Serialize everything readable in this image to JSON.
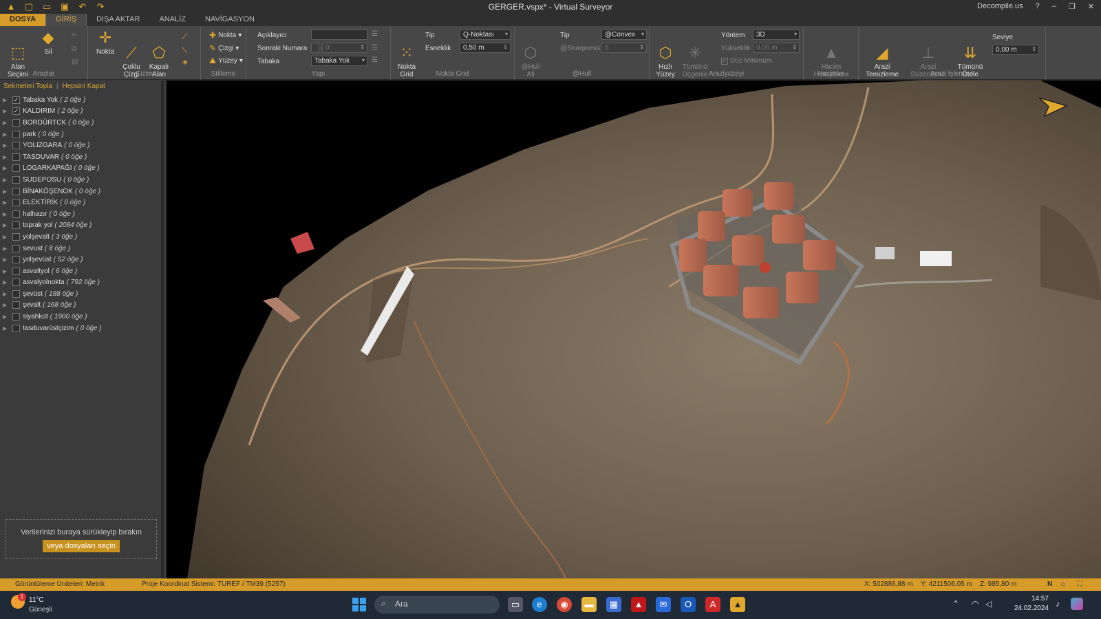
{
  "window": {
    "title": "GERGER.vspx*  -  Virtual Surveyor",
    "decompile": "Decompile.us",
    "help": "?",
    "minimize": "‒",
    "restore": "❐",
    "close": "✕"
  },
  "tabs": [
    "DOSYA",
    "GİRİŞ",
    "DIŞA AKTAR",
    "ANALİZ",
    "NAVİGASYON"
  ],
  "ribbon": {
    "araclar": {
      "label": "Araçlar",
      "alan_secimi": "Alan\nSeçimi",
      "sil": "Sil"
    },
    "cizim": {
      "label": "Çizim",
      "nokta": "Nokta",
      "coklu_cizgi": "Çoklu\nÇizgi",
      "kapali_alan": "Kapalı\nAlan"
    },
    "stilleme": {
      "label": "Stilleme",
      "nokta": "Nokta",
      "cizgi": "Çizgi",
      "yuzey": "Yüzey"
    },
    "yapi": {
      "label": "Yapı",
      "aciklayici": "Açıklayıcı",
      "sonraki_numara": "Sonraki Numara",
      "tabaka": "Tabaka",
      "sonraki_value": "0",
      "tabaka_value": "Tabaka Yok"
    },
    "nokta_grid": {
      "label": "Nokta Grid",
      "button": "Nokta\nGrid",
      "tip": "Tip",
      "esneklik": "Esneklik",
      "tip_value": "Q-Noktası",
      "esneklik_value": "0,50 m"
    },
    "hull": {
      "label": "@Hull",
      "button": "@Hull\nAll",
      "tip": "Tip",
      "sharpness": "@Sharpness",
      "tip_value": "@Convex",
      "sharpness_value": "5"
    },
    "araziyuzeyi": {
      "label": "Araziyüzeyi",
      "hizli": "Hızlı\nYüzey",
      "tumunu": "Tümünü\nÜçgenle",
      "yontem": "Yöntem",
      "yukseklik": "Yükseklik",
      "duz_minimum": "Düz Minimum",
      "yontem_value": "3D",
      "yukseklik_value": "0,00 m"
    },
    "hacimler": {
      "label": "Hacimler",
      "hacim": "Hacim\nHesaplama"
    },
    "arazi_islemleri": {
      "label": "Arazi İşlemleri",
      "temizleme": "Arazi\nTemizleme",
      "duzenleme": "Arazi\nDüzenleme",
      "otele": "Tümünü\nÖtele",
      "seviye": "Seviye",
      "seviye_value": "0,00 m"
    }
  },
  "panel": {
    "collapse": "Sekmeleri Topla",
    "close_all": "Hepsini Kapat",
    "layers": [
      {
        "name": "Tabaka Yok",
        "count": "( 2 öğe )",
        "checked": true
      },
      {
        "name": "KALDIRIM",
        "count": "( 2 öğe )",
        "checked": true
      },
      {
        "name": "BORDÜRTCK",
        "count": "( 0 öğe )",
        "checked": false
      },
      {
        "name": "park",
        "count": "( 0 öğe )",
        "checked": false
      },
      {
        "name": "YOLIZGARA",
        "count": "( 0 öğe )",
        "checked": false
      },
      {
        "name": "TASDUVAR",
        "count": "( 0 öğe )",
        "checked": false
      },
      {
        "name": "LOGARKAPAĞI",
        "count": "( 0 öğe )",
        "checked": false
      },
      {
        "name": "SUDEPOSU",
        "count": "( 0 öğe )",
        "checked": false
      },
      {
        "name": "BİNAKÖŞENOK",
        "count": "( 0 öğe )",
        "checked": false
      },
      {
        "name": "ELEKTİRİK",
        "count": "( 0 öğe )",
        "checked": false
      },
      {
        "name": "halhazır",
        "count": "( 0 öğe )",
        "checked": false
      },
      {
        "name": "toprak yol",
        "count": "( 2084 öğe )",
        "checked": false
      },
      {
        "name": "yolşevalt",
        "count": "( 3 öğe )",
        "checked": false
      },
      {
        "name": "sevust",
        "count": "( 8 öğe )",
        "checked": false
      },
      {
        "name": "yolşevüst",
        "count": "( 52 öğe )",
        "checked": false
      },
      {
        "name": "asvaltyol",
        "count": "( 6 öğe )",
        "checked": false
      },
      {
        "name": "asvalyolnokta",
        "count": "( 792 öğe )",
        "checked": false
      },
      {
        "name": "şevüst",
        "count": "( 188 öğe )",
        "checked": false
      },
      {
        "name": "şevalt",
        "count": "( 168 öğe )",
        "checked": false
      },
      {
        "name": "siyahkot",
        "count": "( 1900 öğe )",
        "checked": false
      },
      {
        "name": "tasduvarüstçizim",
        "count": "( 0 öğe )",
        "checked": false
      }
    ],
    "drop_text": "Verilerinizi buraya sürükleyip bırakın",
    "drop_button": "veya dosyaları seçin"
  },
  "status": {
    "units": "Görüntüleme Üniteleri: Metrik",
    "crs": "Proje Koordinat Sistemi:  TUREF / TM39 (5257)",
    "x": "X: 502886,88 m",
    "y": "Y: 4211506,05 m",
    "z": "Z: 985,80 m",
    "north": "N"
  },
  "taskbar": {
    "weather_temp": "11°C",
    "weather_desc": "Güneşli",
    "search": "Ara",
    "time": "14:57",
    "date": "24.02.2024",
    "badge": "1"
  }
}
